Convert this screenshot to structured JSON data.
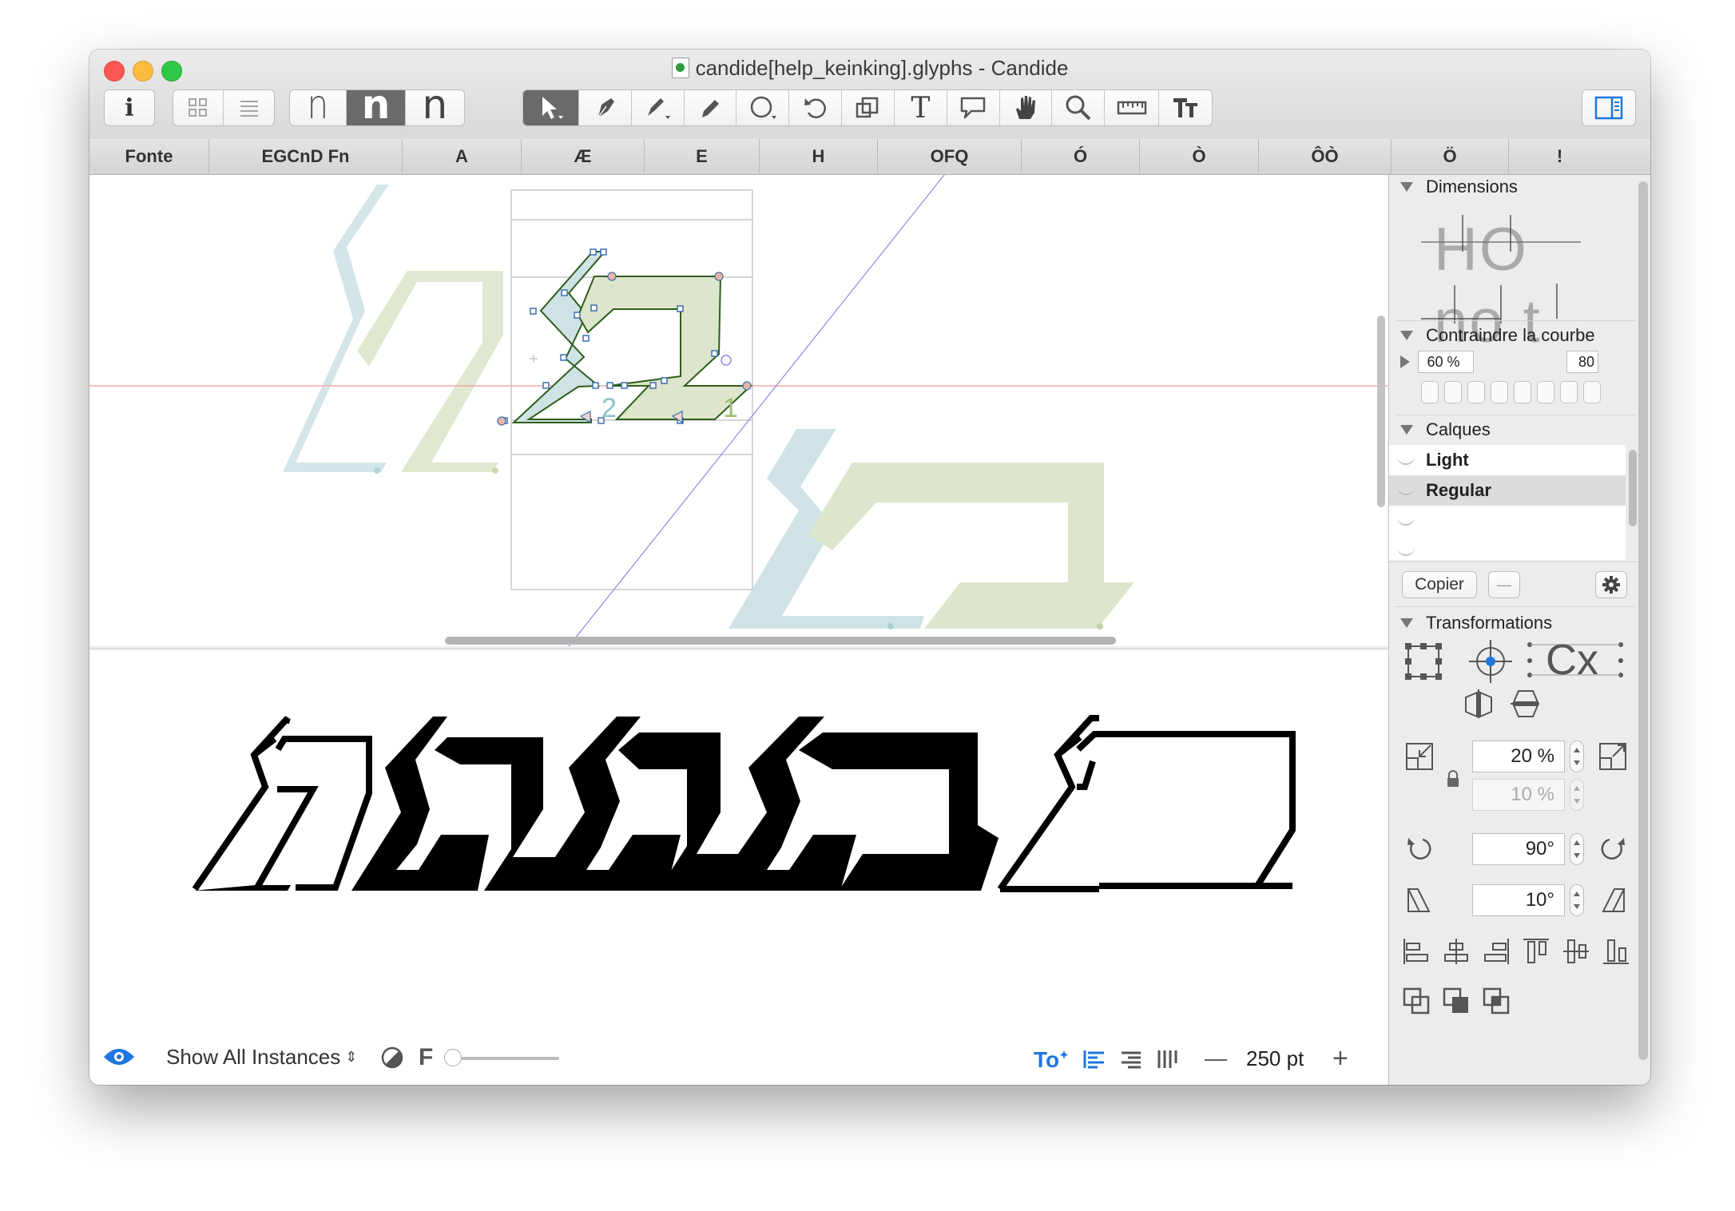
{
  "window": {
    "title": "candide[help_keinking].glyphs - Candide",
    "traffic_lights": {
      "close": "#fc5753",
      "minimize": "#fdbc40",
      "zoom": "#33c748"
    }
  },
  "toolbar": {
    "info_label": "i",
    "view_modes": [
      "grid-icon",
      "list-icon"
    ],
    "masters": [
      {
        "label": "n",
        "weight": "light",
        "active": false
      },
      {
        "label": "n",
        "weight": "bold",
        "active": true
      },
      {
        "label": "n",
        "weight": "regular",
        "active": false
      }
    ],
    "tools": [
      "select-tool-icon",
      "pen-tool-icon",
      "draw-tool-icon",
      "pencil-tool-icon",
      "primitives-tool-icon",
      "rotate-tool-icon",
      "scale-tool-icon",
      "text-tool-icon",
      "annotation-tool-icon",
      "hand-tool-icon",
      "zoom-tool-icon",
      "measurement-tool-icon",
      "kerning-tool-icon"
    ],
    "text_tool_label": "T",
    "sidebar_toggle": "sidebar-toggle-icon"
  },
  "tabs": [
    "Fonte",
    "EGCnD Fn",
    "A",
    "Æ",
    "E",
    "H",
    "OFQ",
    "Ó",
    "Ò",
    "ÔÒ",
    "Ö",
    "!"
  ],
  "editor": {
    "node_labels": [
      "2",
      "1"
    ],
    "colors": {
      "blue_fill": "#cfe3e6",
      "green_fill": "#dde6cc",
      "outline": "#2c5e1a",
      "baseline": "#f2a6a6",
      "guide": "#8080e0"
    }
  },
  "preview": {
    "instances_label": "Show All Instances",
    "f_label": "F",
    "size_value": "250 pt",
    "minus_label": "—",
    "plus_label": "+",
    "text_direction_label": "To"
  },
  "sidebar": {
    "dimensions": {
      "title": "Dimensions",
      "sample_top": "HO",
      "sample_bottom": "no t"
    },
    "curve": {
      "title": "Contraindre la courbe",
      "percent": "60 %",
      "value": "80"
    },
    "layers": {
      "title": "Calques",
      "items": [
        {
          "name": "Light",
          "selected": false
        },
        {
          "name": "Regular",
          "selected": true
        },
        {
          "name": "",
          "selected": false
        },
        {
          "name": "",
          "selected": false
        }
      ],
      "copy_label": "Copier",
      "remove_label": "—"
    },
    "transformations": {
      "title": "Transformations",
      "text_sample": "Cx",
      "scale_x": "20 %",
      "scale_y": "10 %",
      "rotate": "90°",
      "slant": "10°"
    }
  }
}
